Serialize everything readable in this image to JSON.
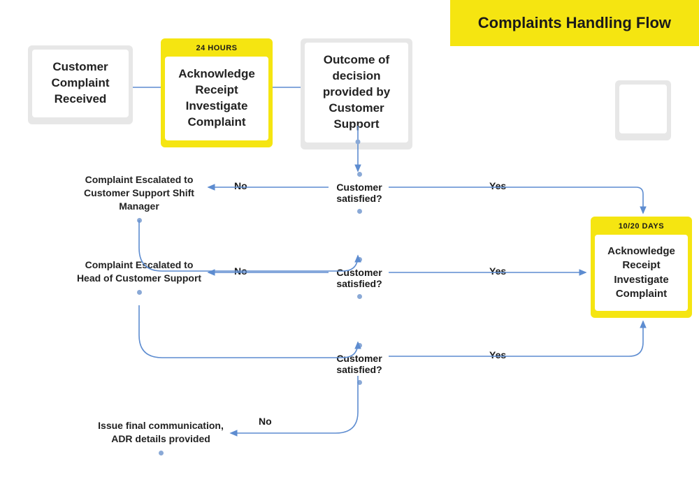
{
  "title": "Complaints Handling Flow",
  "cards": {
    "c1": {
      "text": "Customer Complaint Received"
    },
    "c2": {
      "time": "24 HOURS",
      "text": "Acknowledge Receipt Investigate Complaint"
    },
    "c3": {
      "text": "Outcome of decision provided by Customer Support"
    },
    "c4": {
      "time": "10/20 DAYS",
      "text": "Acknowledge Receipt Investigate Complaint"
    }
  },
  "decisions": {
    "d1": "Customer satisfied?",
    "d2": "Customer satisfied?",
    "d3": "Customer satisfied?"
  },
  "escalations": {
    "e1": "Complaint Escalated to Customer Support Shift Manager",
    "e2": "Complaint Escalated to Head of Customer Support",
    "e3": "Issue final communication, ADR details provided"
  },
  "labels": {
    "no1": "No",
    "no2": "No",
    "no3": "No",
    "yes1": "Yes",
    "yes2": "Yes",
    "yes3": "Yes"
  },
  "colors": {
    "yellow": "#f5e511",
    "grey": "#e7e7e7",
    "line": "#5d8cd0"
  }
}
